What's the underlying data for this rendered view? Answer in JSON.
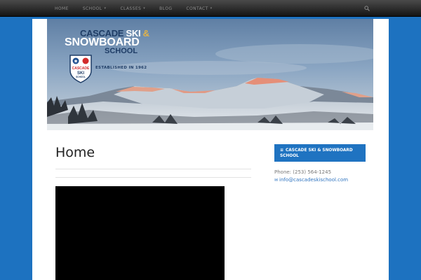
{
  "nav": {
    "items": [
      {
        "label": "Home",
        "has_caret": false
      },
      {
        "label": "School",
        "has_caret": true
      },
      {
        "label": "Classes",
        "has_caret": true
      },
      {
        "label": "Blog",
        "has_caret": false
      },
      {
        "label": "Contact",
        "has_caret": true
      }
    ],
    "caret": "▾",
    "search_icon": "search-icon"
  },
  "logo": {
    "line1_a": "CASCADE ",
    "line1_b": "SKI",
    "line1_amp": " &",
    "line2": "SNOWBOARD",
    "line3": "SCHOOL",
    "established": "ESTABLISHED IN 1962",
    "badge_top": "CASCADE",
    "badge_ski": "SKI",
    "badge_school": "SCHOOL"
  },
  "main": {
    "title": "Home"
  },
  "sidebar": {
    "widget_title": "Cascade Ski & Snowboard School",
    "menu_icon": "≡",
    "phone": "Phone: (253) 564-1245",
    "mail_icon": "✉",
    "email": "info@cascadeskischool.com"
  },
  "colors": {
    "background": "#1d72c0",
    "accent": "#1f73c1",
    "link": "#2f74c0"
  }
}
